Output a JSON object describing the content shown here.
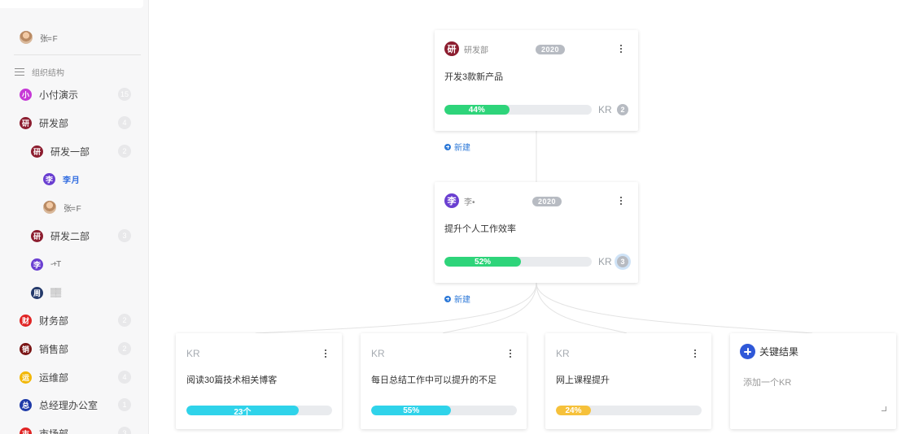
{
  "sidebar": {
    "user_name": "张= F",
    "section_label": "组织结构",
    "items": [
      {
        "avatar_char": "小",
        "avatar_color": "#c638d6",
        "label": "小付演示",
        "count": "15",
        "style": "normal"
      },
      {
        "avatar_char": "研",
        "avatar_color": "#8c1d2f",
        "label": "研发部",
        "count": "4",
        "style": "normal"
      },
      {
        "avatar_char": "研",
        "avatar_color": "#8c1d2f",
        "label": "研发一部",
        "count": "2",
        "style": "normal"
      },
      {
        "avatar_char": "李",
        "avatar_color": "#6a3fd1",
        "label": "李 月",
        "count": "",
        "style": "blue"
      },
      {
        "avatar_char": "",
        "avatar_color": "",
        "label": "张= F",
        "count": "",
        "style": "blurred"
      },
      {
        "avatar_char": "研",
        "avatar_color": "#8c1d2f",
        "label": "研发二部",
        "count": "3",
        "style": "normal"
      },
      {
        "avatar_char": "李",
        "avatar_color": "#6a3fd1",
        "label": "-+Т",
        "count": "",
        "style": "blurred"
      },
      {
        "avatar_char": "周",
        "avatar_color": "#243a6b",
        "label": "▒▒",
        "count": "",
        "style": "blurred"
      },
      {
        "avatar_char": "财",
        "avatar_color": "#e02424",
        "label": "财务部",
        "count": "2",
        "style": "normal"
      },
      {
        "avatar_char": "销",
        "avatar_color": "#7a1515",
        "label": "销售部",
        "count": "2",
        "style": "normal"
      },
      {
        "avatar_char": "运",
        "avatar_color": "#f2b705",
        "label": "运维部",
        "count": "4",
        "style": "normal"
      },
      {
        "avatar_char": "总",
        "avatar_color": "#1e3aa8",
        "label": "总经理办公室",
        "count": "1",
        "style": "normal"
      },
      {
        "avatar_char": "市",
        "avatar_color": "#e02424",
        "label": "市场部",
        "count": "3",
        "style": "normal"
      }
    ]
  },
  "objectives": [
    {
      "avatar_char": "研",
      "avatar_color": "#8c1d2f",
      "owner": "研发部",
      "year": "2020",
      "title": "开发3款新产品",
      "progress_label": "44%",
      "progress_value": 44,
      "kr_label": "KR",
      "kr_count": "2",
      "new_label": "新建"
    },
    {
      "avatar_char": "李",
      "avatar_color": "#6a3fd1",
      "owner": "李•",
      "year": "2020",
      "title": "提升个人工作效率",
      "progress_label": "52%",
      "progress_value": 52,
      "kr_label": "KR",
      "kr_count": "3",
      "new_label": "新建"
    }
  ],
  "key_results": [
    {
      "label": "KR",
      "title": "阅读30篇技术相关博客",
      "progress_label": "23个",
      "progress_value": 77,
      "color": "#2fd3ea"
    },
    {
      "label": "KR",
      "title": "每日总结工作中可以提升的不足",
      "progress_label": "55%",
      "progress_value": 55,
      "color": "#2fd3ea"
    },
    {
      "label": "KR",
      "title": "网上课程提升",
      "progress_label": "24%",
      "progress_value": 24,
      "color": "#f6c13a"
    }
  ],
  "add_kr": {
    "title": "关键结果",
    "placeholder": "添加一个KR"
  },
  "colors": {
    "progress_green": "#2ed47a",
    "accent_blue": "#2f7ad8"
  }
}
